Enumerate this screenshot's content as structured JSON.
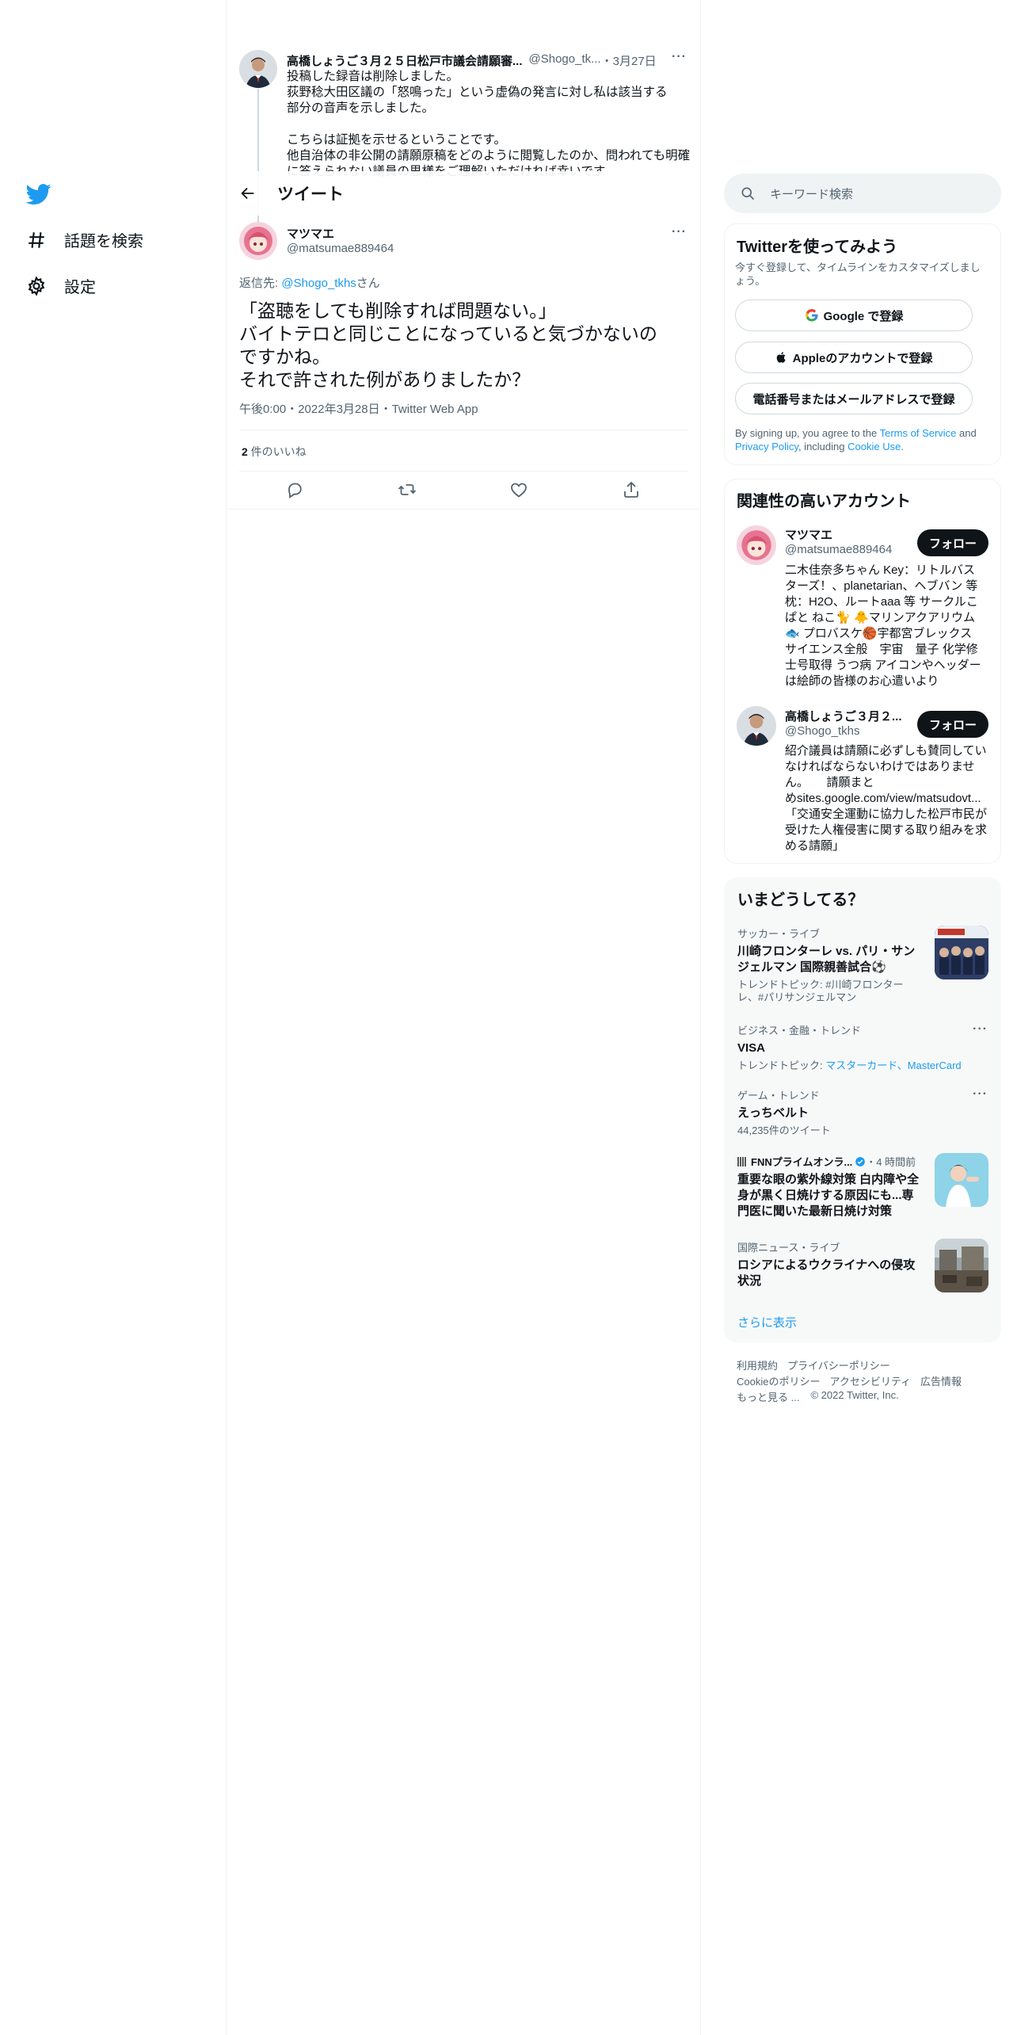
{
  "nav": {
    "explore_label": "話題を検索",
    "settings_label": "設定"
  },
  "prev_tweet": {
    "name": "高橋しょうご３月２５日松戸市議会請願審...",
    "handle": "@Shogo_tk...",
    "date": "・3月27日",
    "lines": [
      "投稿した録音は削除しました。",
      "荻野稔大田区議の「怒鳴った」という虚偽の発言に対し私は該当する",
      "部分の音声を示しました。",
      "",
      "こちらは証拠を示せるということです。",
      "他自治体の非公開の請願原稿をどのように閲覧したのか、問われても明確",
      "に答えられない議員の思様をご理解いただければ幸いです"
    ]
  },
  "header": {
    "title": "ツイート"
  },
  "tweet": {
    "name": "マツマエ",
    "handle": "@matsumae889464",
    "reply_prefix": "返信先: ",
    "reply_to": "@Shogo_tkhs",
    "reply_suffix": "さん",
    "body_lines": [
      "「盗聴をしても削除すれば問題ない。」",
      "バイトテロと同じことになっていると気づかないの",
      "ですかね。",
      "それで許された例がありましたか？"
    ],
    "meta": "午後0:00・2022年3月28日・Twitter Web App",
    "likes_count": "2",
    "likes_label": " 件のいいね"
  },
  "search": {
    "placeholder": "キーワード検索"
  },
  "signup": {
    "title": "Twitterを使ってみよう",
    "subtitle": "今すぐ登録して、タイムラインをカスタマイズしましょう。",
    "google_label": "Google で登録",
    "apple_label": "Appleのアカウントで登録",
    "email_label": "電話番号またはメールアドレスで登録",
    "terms_prefix": "By signing up, you agree to the ",
    "terms_link": "Terms of Service",
    "terms_and": " and",
    "privacy_link": "Privacy Policy",
    "including": ", including ",
    "cookie_link": "Cookie Use",
    "period": "."
  },
  "related": {
    "title": "関連性の高いアカウント",
    "follow_label": "フォロー",
    "accounts": [
      {
        "name": "マツマエ",
        "handle": "@matsumae889464",
        "bio_lines": [
          "二木佳奈多ちゃん Key：リトルバス",
          "ターズ！、planetarian、ヘブバン 等",
          "枕：H2O、ルートaaa 等 サークルこ",
          "ぱと ねこ🐈 🐥マリンアクアリウム",
          "🐟 プロバスケ🏀宇都宮ブレックス",
          "サイエンス全般　宇宙　量子 化学修",
          "士号取得 うつ病 アイコンやヘッダー",
          "は絵師の皆様のお心遣いより"
        ]
      },
      {
        "name": "高橋しょうご３月２...",
        "handle": "@Shogo_tkhs",
        "bio_lines": [
          "紹介議員は請願に必ずしも賛同してい",
          "なければならないわけではありませ",
          "ん。　　請願まと",
          "めsites.google.com/view/matsudovt...",
          "「交通安全運動に協力した松戸市民が",
          "受けた人権侵害に関する取り組みを求",
          "める請願」"
        ]
      }
    ]
  },
  "trends": {
    "title": "いまどうしてる？",
    "items": [
      {
        "context": "サッカー・ライブ",
        "title_lines": [
          "川崎フロンターレ vs. パリ・サン",
          "ジェルマン 国際親善試合⚽"
        ],
        "sub_lines": [
          "トレンドトピック: #川崎フロンター",
          "レ、#パリサンジェルマン"
        ]
      },
      {
        "context": "ビジネス・金融・トレンド",
        "title_lines": [
          "VISA"
        ],
        "sub_prefix": "トレンドトピック: ",
        "sub_links": "マスターカード、MasterCard"
      },
      {
        "context": "ゲーム・トレンド",
        "title_lines": [
          "えっちベルト"
        ],
        "sub_text": "44,235件のツイート"
      },
      {
        "context": "FNNプライムオンラ...",
        "time": "・4 時間前",
        "title_lines": [
          "重要な眼の紫外線対策 白内障や全",
          "身が黒く日焼けする原因にも...専",
          "門医に聞いた最新日焼け対策"
        ]
      },
      {
        "context": "国際ニュース・ライブ",
        "title_lines": [
          "ロシアによるウクライナへの侵攻",
          "状況"
        ]
      }
    ],
    "show_more": "さらに表示"
  },
  "footer": {
    "links_row1": [
      "利用規約",
      "プライバシーポリシー"
    ],
    "links_row2": [
      "Cookieのポリシー",
      "アクセシビリティ",
      "広告情報"
    ],
    "more": "もっと見る ...",
    "copyright": "© 2022 Twitter, Inc."
  },
  "colors": {
    "accent": "#1d9bf0",
    "text": "#0f1419",
    "muted": "#536471",
    "border": "#eff3f4"
  }
}
